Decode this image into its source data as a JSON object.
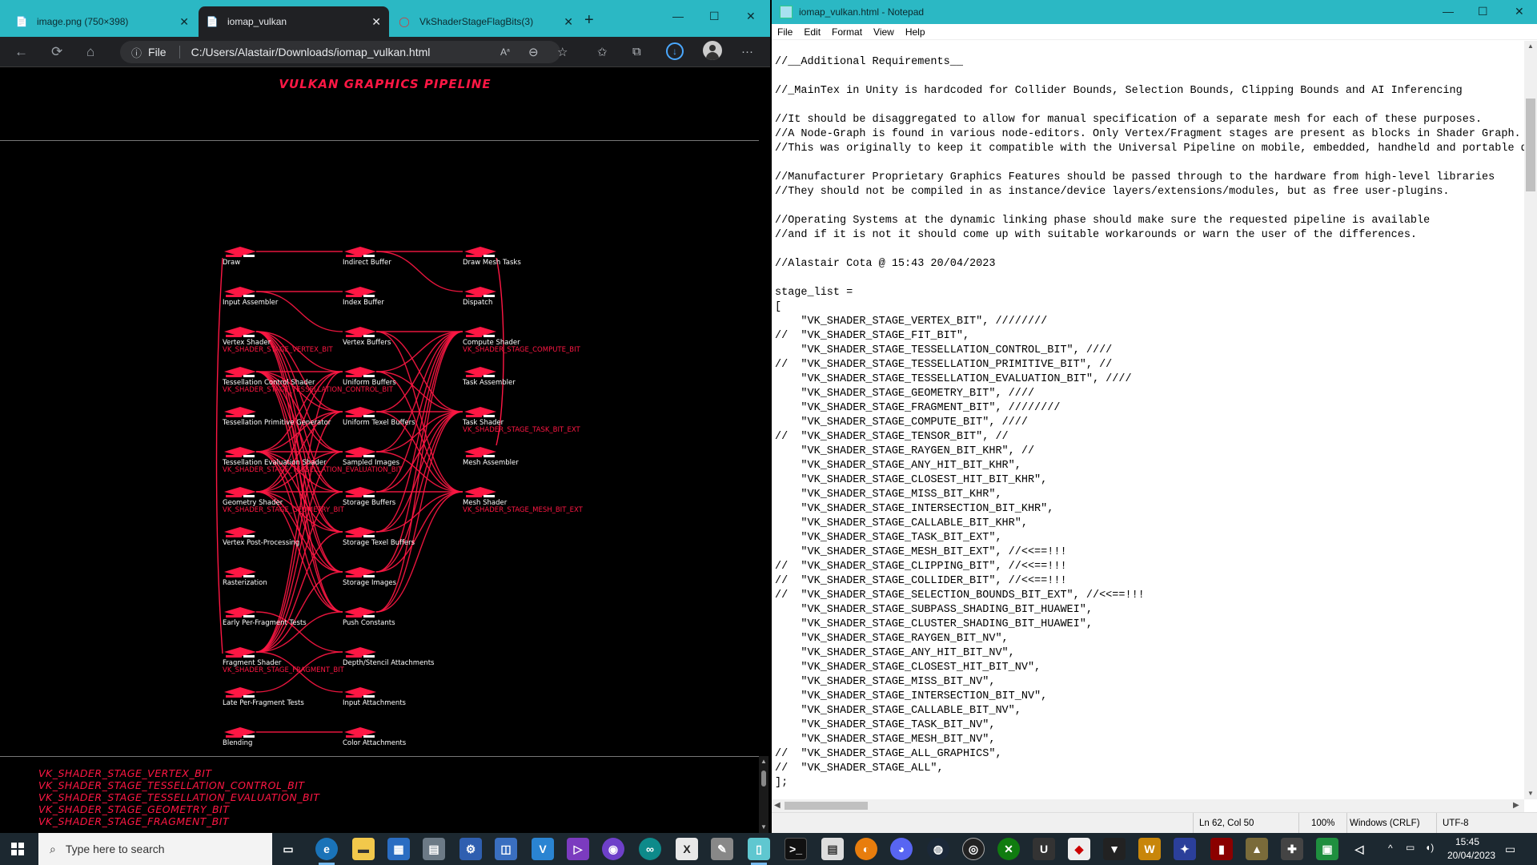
{
  "browser": {
    "tabs": [
      {
        "label": "image.png (750×398)",
        "icon": "file-icon"
      },
      {
        "label": "iomap_vulkan",
        "icon": "file-icon",
        "active": true
      },
      {
        "label": "VkShaderStageFlagBits(3)",
        "icon": "web-icon"
      }
    ],
    "address": {
      "scheme": "File",
      "url": "C:/Users/Alastair/Downloads/iomap_vulkan.html"
    }
  },
  "page": {
    "title": "VULKAN GRAPHICS PIPELINE",
    "nodes_col1": [
      {
        "label": "Draw",
        "sub": ""
      },
      {
        "label": "Input Assembler",
        "sub": ""
      },
      {
        "label": "Vertex Shader",
        "sub": "VK_SHADER_STAGE_VERTEX_BIT"
      },
      {
        "label": "Tessellation Control Shader",
        "sub": "VK_SHADER_STAGE_TESSELLATION_CONTROL_BIT"
      },
      {
        "label": "Tessellation Primitive Generator",
        "sub": ""
      },
      {
        "label": "Tessellation Evaluation Shader",
        "sub": "VK_SHADER_STAGE_TESSELLATION_EVALUATION_BIT"
      },
      {
        "label": "Geometry Shader",
        "sub": "VK_SHADER_STAGE_GEOMETRY_BIT"
      },
      {
        "label": "Vertex Post-Processing",
        "sub": ""
      },
      {
        "label": "Rasterization",
        "sub": ""
      },
      {
        "label": "Early Per-Fragment Tests",
        "sub": ""
      },
      {
        "label": "Fragment Shader",
        "sub": "VK_SHADER_STAGE_FRAGMENT_BIT"
      },
      {
        "label": "Late Per-Fragment Tests",
        "sub": ""
      },
      {
        "label": "Blending",
        "sub": ""
      }
    ],
    "nodes_col2": [
      {
        "label": "Indirect Buffer",
        "sub": ""
      },
      {
        "label": "Index Buffer",
        "sub": ""
      },
      {
        "label": "Vertex Buffers",
        "sub": ""
      },
      {
        "label": "Uniform Buffers",
        "sub": ""
      },
      {
        "label": "Uniform Texel Buffers",
        "sub": ""
      },
      {
        "label": "Sampled Images",
        "sub": ""
      },
      {
        "label": "Storage Buffers",
        "sub": ""
      },
      {
        "label": "Storage Texel Buffers",
        "sub": ""
      },
      {
        "label": "Storage Images",
        "sub": ""
      },
      {
        "label": "Push Constants",
        "sub": ""
      },
      {
        "label": "Depth/Stencil Attachments",
        "sub": ""
      },
      {
        "label": "Input Attachments",
        "sub": ""
      },
      {
        "label": "Color Attachments",
        "sub": ""
      }
    ],
    "nodes_col3": [
      {
        "label": "Draw Mesh Tasks",
        "sub": ""
      },
      {
        "label": "Dispatch",
        "sub": ""
      },
      {
        "label": "Compute Shader",
        "sub": "VK_SHADER_STAGE_COMPUTE_BIT"
      },
      {
        "label": "Task Assembler",
        "sub": ""
      },
      {
        "label": "Task Shader",
        "sub": "VK_SHADER_STAGE_TASK_BIT_EXT"
      },
      {
        "label": "Mesh Assembler",
        "sub": ""
      },
      {
        "label": "Mesh Shader",
        "sub": "VK_SHADER_STAGE_MESH_BIT_EXT"
      }
    ],
    "bit_list": [
      "VK_SHADER_STAGE_VERTEX_BIT",
      "VK_SHADER_STAGE_TESSELLATION_CONTROL_BIT",
      "VK_SHADER_STAGE_TESSELLATION_EVALUATION_BIT",
      "VK_SHADER_STAGE_GEOMETRY_BIT",
      "VK_SHADER_STAGE_FRAGMENT_BIT"
    ]
  },
  "notepad": {
    "title": "iomap_vulkan.html - Notepad",
    "menu": [
      "File",
      "Edit",
      "Format",
      "View",
      "Help"
    ],
    "lines": [
      "//__Additional Requirements__",
      "",
      "//_MainTex in Unity is hardcoded for Collider Bounds, Selection Bounds, Clipping Bounds and AI Inferencing",
      "",
      "//It should be disaggregated to allow for manual specification of a separate mesh for each of these purposes.",
      "//A Node-Graph is found in various node-editors. Only Vertex/Fragment stages are present as blocks in Shader Graph.",
      "//This was originally to keep it compatible with the Universal Pipeline on mobile, embedded, handheld and portable de",
      "",
      "//Manufacturer Proprietary Graphics Features should be passed through to the hardware from high-level libraries",
      "//They should not be compiled in as instance/device layers/extensions/modules, but as free user-plugins.",
      "",
      "//Operating Systems at the dynamic linking phase should make sure the requested pipeline is available",
      "//and if it is not it should come up with suitable workarounds or warn the user of the differences.",
      "",
      "//Alastair Cota @ 15:43 20/04/2023",
      "",
      "stage_list =",
      "[",
      "    \"VK_SHADER_STAGE_VERTEX_BIT\", ////////",
      "//  \"VK_SHADER_STAGE_FIT_BIT\",",
      "    \"VK_SHADER_STAGE_TESSELLATION_CONTROL_BIT\", ////",
      "//  \"VK_SHADER_STAGE_TESSELLATION_PRIMITIVE_BIT\", //",
      "    \"VK_SHADER_STAGE_TESSELLATION_EVALUATION_BIT\", ////",
      "    \"VK_SHADER_STAGE_GEOMETRY_BIT\", ////",
      "    \"VK_SHADER_STAGE_FRAGMENT_BIT\", ////////",
      "    \"VK_SHADER_STAGE_COMPUTE_BIT\", ////",
      "//  \"VK_SHADER_STAGE_TENSOR_BIT\", //",
      "    \"VK_SHADER_STAGE_RAYGEN_BIT_KHR\", //",
      "    \"VK_SHADER_STAGE_ANY_HIT_BIT_KHR\",",
      "    \"VK_SHADER_STAGE_CLOSEST_HIT_BIT_KHR\",",
      "    \"VK_SHADER_STAGE_MISS_BIT_KHR\",",
      "    \"VK_SHADER_STAGE_INTERSECTION_BIT_KHR\",",
      "    \"VK_SHADER_STAGE_CALLABLE_BIT_KHR\",",
      "    \"VK_SHADER_STAGE_TASK_BIT_EXT\",",
      "    \"VK_SHADER_STAGE_MESH_BIT_EXT\", //<<==!!!",
      "//  \"VK_SHADER_STAGE_CLIPPING_BIT\", //<<==!!!",
      "//  \"VK_SHADER_STAGE_COLLIDER_BIT\", //<<==!!!",
      "//  \"VK_SHADER_STAGE_SELECTION_BOUNDS_BIT_EXT\", //<<==!!!",
      "    \"VK_SHADER_STAGE_SUBPASS_SHADING_BIT_HUAWEI\",",
      "    \"VK_SHADER_STAGE_CLUSTER_SHADING_BIT_HUAWEI\",",
      "    \"VK_SHADER_STAGE_RAYGEN_BIT_NV\",",
      "    \"VK_SHADER_STAGE_ANY_HIT_BIT_NV\",",
      "    \"VK_SHADER_STAGE_CLOSEST_HIT_BIT_NV\",",
      "    \"VK_SHADER_STAGE_MISS_BIT_NV\",",
      "    \"VK_SHADER_STAGE_INTERSECTION_BIT_NV\",",
      "    \"VK_SHADER_STAGE_CALLABLE_BIT_NV\",",
      "    \"VK_SHADER_STAGE_TASK_BIT_NV\",",
      "    \"VK_SHADER_STAGE_MESH_BIT_NV\",",
      "//  \"VK_SHADER_STAGE_ALL_GRAPHICS\",",
      "//  \"VK_SHADER_STAGE_ALL\",",
      "];"
    ],
    "status": {
      "position": "Ln 62, Col 50",
      "zoom": "100%",
      "eol": "Windows (CRLF)",
      "encoding": "UTF-8"
    }
  },
  "taskbar": {
    "search_placeholder": "Type here to search",
    "time": "15:45",
    "date": "20/04/2023"
  },
  "colors": {
    "accent": "#2bb8c4",
    "pipeline_red": "#ff1744"
  }
}
